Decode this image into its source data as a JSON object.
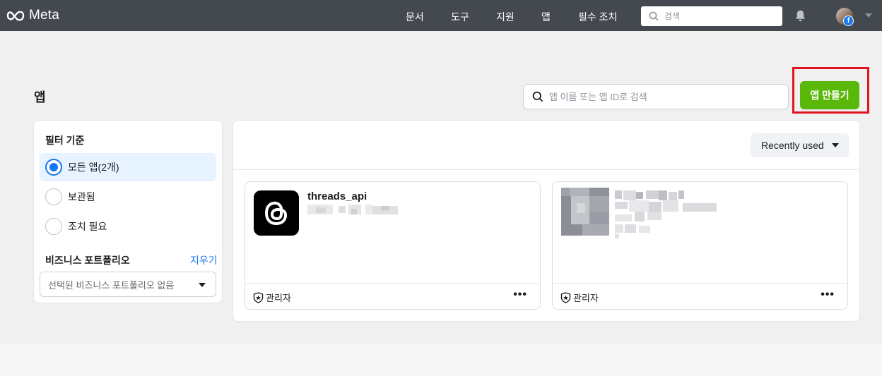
{
  "topbar": {
    "logo_text": "Meta",
    "nav": [
      "문서",
      "도구",
      "지원",
      "앱",
      "필수 조치"
    ],
    "search_placeholder": "검색",
    "badge_text": "f"
  },
  "page": {
    "title": "앱",
    "search_placeholder": "앱 이름 또는 앱 ID로 검색",
    "create_button": "앱 만들기"
  },
  "filter": {
    "title": "필터 기준",
    "options": [
      {
        "label": "모든 앱(2개)",
        "selected": true
      },
      {
        "label": "보관됨",
        "selected": false
      },
      {
        "label": "조치 필요",
        "selected": false
      }
    ],
    "business_title": "비즈니스 포트폴리오",
    "clear_label": "지우기",
    "business_select": "선택된 비즈니스 포트폴리오 없음"
  },
  "apps": {
    "sort_label": "Recently used",
    "cards": [
      {
        "name": "threads_api",
        "role": "관리자",
        "icon": "threads-icon"
      },
      {
        "name": "",
        "role": "관리자",
        "icon": "blurred-app-icon"
      }
    ],
    "more_label": "•••"
  },
  "colors": {
    "topbar": "#444950",
    "primary": "#1877f2",
    "create_button": "#5ab80a",
    "highlight": "#e0141e"
  }
}
